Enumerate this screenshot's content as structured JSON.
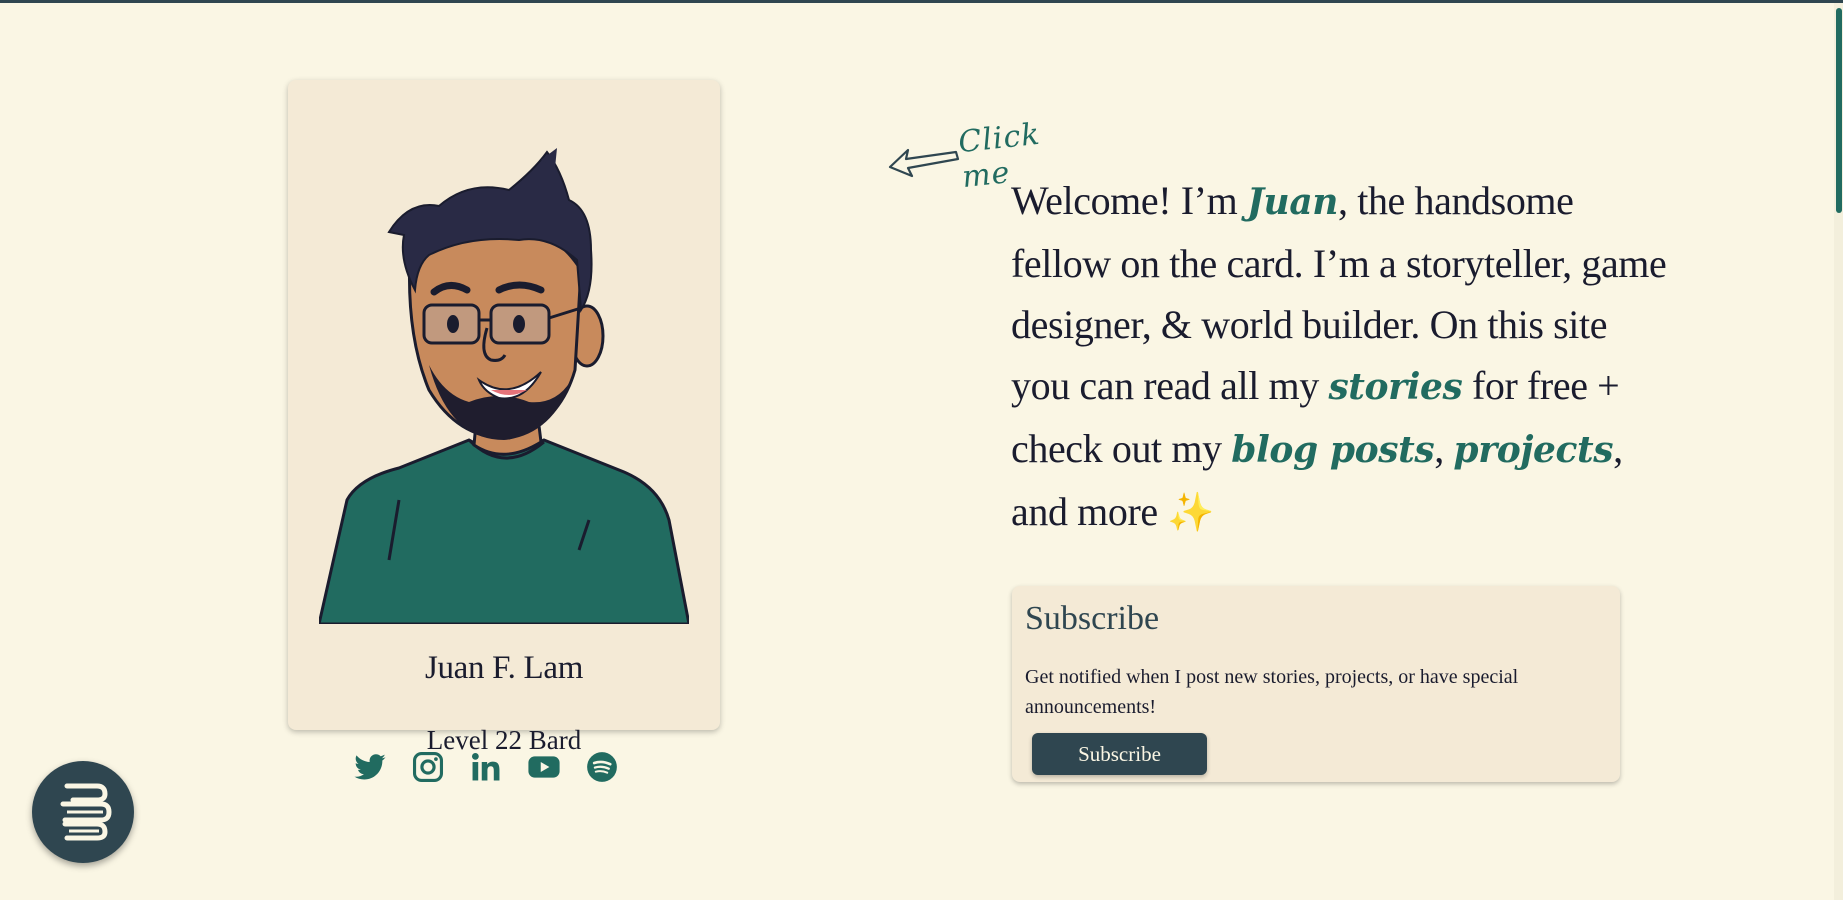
{
  "card": {
    "name": "Juan F. Lam",
    "class": "Level 22 Bard"
  },
  "socials": [
    {
      "name": "twitter-icon"
    },
    {
      "name": "instagram-icon"
    },
    {
      "name": "linkedin-icon"
    },
    {
      "name": "youtube-icon"
    },
    {
      "name": "spotify-icon"
    }
  ],
  "hint": {
    "click_me": "Click me"
  },
  "intro": {
    "p1": "Welcome! I’m ",
    "name_link": "Juan",
    "p2": ", the handsome fellow on the card. I’m a storyteller, game designer, & world builder. On this site you can read all my ",
    "stories_link": "stories",
    "p3": " for free + check out my ",
    "blog_link": "blog posts",
    "p4": ", ",
    "projects_link": "projects",
    "p5": ", and more ",
    "sparkle": "✨"
  },
  "subscribe": {
    "title": "Subscribe",
    "description": "Get notified when I post new stories, projects, or have special announcements!",
    "button_label": "Subscribe"
  },
  "colors": {
    "background": "#faf6e4",
    "card": "#f4ead6",
    "accent_green": "#216b60",
    "dark_slate": "#2f4650",
    "text": "#1a1c2e"
  }
}
